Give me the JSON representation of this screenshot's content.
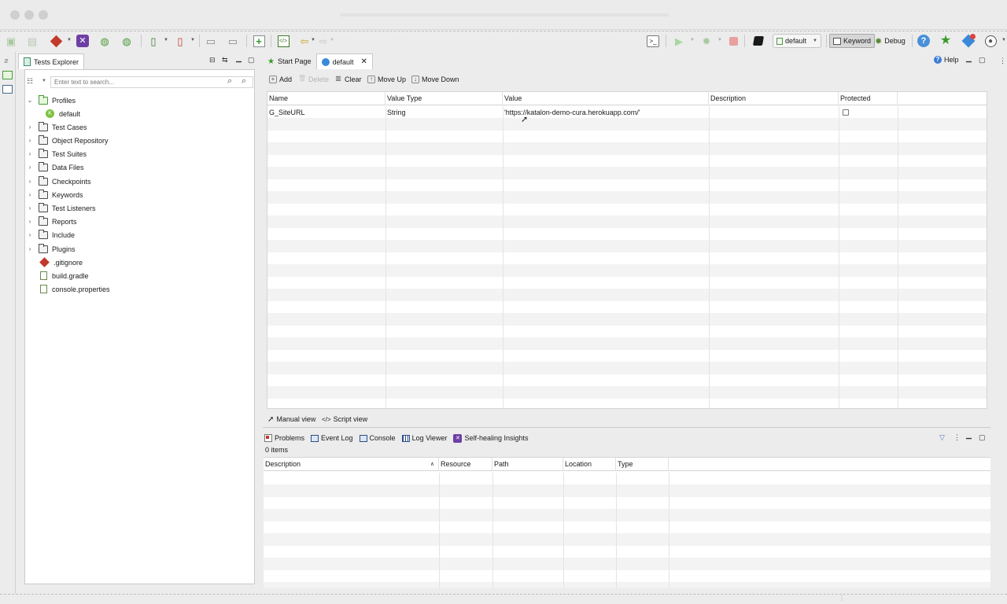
{
  "toolbar": {
    "profile_value": "default",
    "keyword_label": "Keyword",
    "debug_label": "Debug"
  },
  "explorer": {
    "title": "Tests Explorer",
    "search_placeholder": "Enter text to search...",
    "items": [
      {
        "label": "Profiles"
      },
      {
        "label": "default"
      },
      {
        "label": "Test Cases"
      },
      {
        "label": "Object Repository"
      },
      {
        "label": "Test Suites"
      },
      {
        "label": "Data Files"
      },
      {
        "label": "Checkpoints"
      },
      {
        "label": "Keywords"
      },
      {
        "label": "Test Listeners"
      },
      {
        "label": "Reports"
      },
      {
        "label": "Include"
      },
      {
        "label": "Plugins"
      },
      {
        "label": ".gitignore"
      },
      {
        "label": "build.gradle"
      },
      {
        "label": "console.properties"
      }
    ]
  },
  "editor": {
    "tabs": [
      {
        "label": "Start Page"
      },
      {
        "label": "default"
      }
    ],
    "help_label": "Help",
    "actions": {
      "add": "Add",
      "delete": "Delete",
      "clear": "Clear",
      "move_up": "Move Up",
      "move_down": "Move Down"
    },
    "columns": [
      "Name",
      "Value Type",
      "Value",
      "Description",
      "Protected"
    ],
    "rows": [
      {
        "name": "G_SiteURL",
        "type": "String",
        "value": "'https://katalon-demo-cura.herokuapp.com/'",
        "description": "",
        "protected": false
      }
    ],
    "views": {
      "manual": "Manual view",
      "script": "Script view"
    }
  },
  "bottom": {
    "tabs": [
      {
        "label": "Problems"
      },
      {
        "label": "Event Log"
      },
      {
        "label": "Console"
      },
      {
        "label": "Log Viewer"
      },
      {
        "label": "Self-healing Insights"
      }
    ],
    "count_label": "0 items",
    "columns": [
      "Description",
      "Resource",
      "Path",
      "Location",
      "Type"
    ]
  }
}
